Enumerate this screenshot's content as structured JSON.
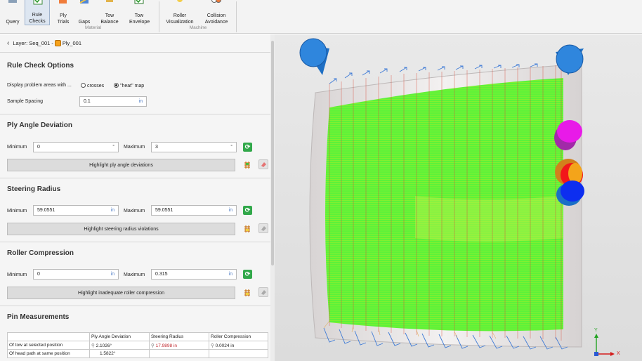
{
  "ribbon": {
    "buttons": [
      {
        "label": "Query",
        "icon": "query-icon"
      },
      {
        "label": "Rule Checks",
        "icon": "rule-checks-icon"
      },
      {
        "label": "Ply Trials",
        "icon": "ply-trials-icon"
      },
      {
        "label": "Gaps",
        "icon": "gaps-icon"
      },
      {
        "label": "Tow Balance",
        "icon": "tow-balance-icon"
      },
      {
        "label": "Tow Envelope",
        "icon": "tow-envelope-icon"
      },
      {
        "label": "Roller Visualization",
        "icon": "roller-visualization-icon"
      },
      {
        "label": "Collision Avoidance",
        "icon": "collision-avoidance-icon"
      }
    ],
    "groups": {
      "material": "Material",
      "machine": "Machine"
    }
  },
  "breadcrumb": {
    "prefix": "Layer: Seq_001 - ",
    "ply": "Ply_001"
  },
  "rule_check_options": {
    "title": "Rule Check Options",
    "display_label": "Display problem areas with ...",
    "option_crosses": "crosses",
    "option_heatmap": "\"heat\" map",
    "selected": "heatmap",
    "spacing_label": "Sample Spacing",
    "spacing_value": "0.1",
    "spacing_unit": "in"
  },
  "ply_angle": {
    "title": "Ply Angle Deviation",
    "min_label": "Minimum",
    "min_value": "0",
    "min_unit": "°",
    "max_label": "Maximum",
    "max_value": "3",
    "max_unit": "°",
    "button": "Highlight ply angle deviations"
  },
  "steering": {
    "title": "Steering Radius",
    "min_label": "Minimum",
    "min_value": "59.0551",
    "min_unit": "in",
    "max_label": "Maximum",
    "max_value": "59.0551",
    "max_unit": "in",
    "button": "Highlight steering radius violations"
  },
  "roller": {
    "title": "Roller Compression",
    "min_label": "Minimum",
    "min_value": "0",
    "min_unit": "in",
    "max_label": "Maximum",
    "max_value": "0.315",
    "max_unit": "in",
    "button": "Highlight inadequate roller compression"
  },
  "pin": {
    "title": "Pin Measurements",
    "headers": [
      "",
      "Ply Angle Deviation",
      "Steering Radius",
      "Roller Compression"
    ],
    "rows": [
      {
        "label": "Of tow at selected position",
        "angle": "2.1026°",
        "radius": "17.9898 in",
        "compression": "0.0024 in"
      },
      {
        "label": "Of head path at same position",
        "angle": "1.5822°",
        "radius": "",
        "compression": ""
      }
    ]
  },
  "axes": {
    "x": "X",
    "y": "Y"
  },
  "colors": {
    "heatmap": "#5cf23a",
    "accent": "#4a79c4",
    "violation": "#c0262c"
  }
}
